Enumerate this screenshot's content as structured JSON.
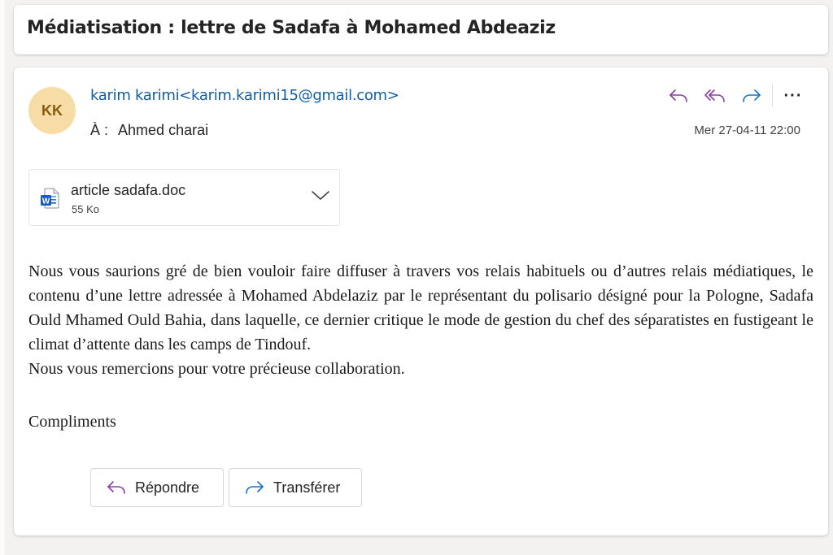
{
  "subject": "Médiatisation : lettre de Sadafa à Mohamed Abdeaziz",
  "message": {
    "avatar_initials": "KK",
    "sender": "karim karimi<karim.karimi15@gmail.com>",
    "to_label": "À :",
    "to_value": "Ahmed charai",
    "date": "Mer 27-04-11 22:00",
    "actions": {
      "reply_icon": "reply-arrow-icon",
      "reply_all_icon": "reply-all-icon",
      "forward_icon": "forward-arrow-icon",
      "more_label": "···"
    },
    "attachment": {
      "icon": "word-doc-icon",
      "name": "article sadafa.doc",
      "size": "55 Ko"
    },
    "body": {
      "paragraph1": "Nous vous saurions gré de bien vouloir faire diffuser à travers vos relais habituels ou d’autres relais médiatiques, le contenu d’une lettre adressée à Mohamed Abdelaziz par le représentant du polisario désigné pour la Pologne, Sadafa Ould Mhamed Ould Bahia, dans laquelle, ce dernier critique le mode de gestion du chef des séparatistes en fustigeant le climat d’attente dans les camps de Tindouf.",
      "paragraph2": "Nous vous remercions pour votre précieuse collaboration.",
      "signoff": "Compliments"
    },
    "buttons": {
      "reply_label": "Répondre",
      "forward_label": "Transférer"
    }
  },
  "colors": {
    "accent_purple": "#8a3fa8",
    "accent_blue": "#1a73c9",
    "sender_link": "#115ea3",
    "avatar_bg": "#f7dca5"
  }
}
